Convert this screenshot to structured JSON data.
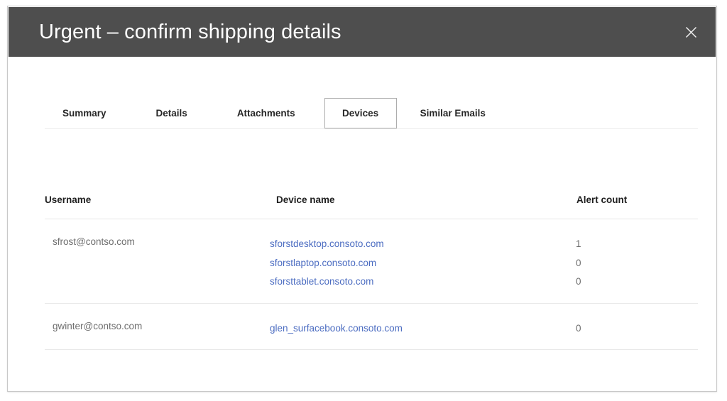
{
  "dialog": {
    "title": "Urgent – confirm shipping details",
    "close_icon": "close-icon",
    "header_bg": "#4e4e4e",
    "link_color": "#4b6cc1"
  },
  "tabs": [
    {
      "label": "Summary",
      "selected": false
    },
    {
      "label": "Details",
      "selected": false
    },
    {
      "label": "Attachments",
      "selected": false
    },
    {
      "label": "Devices",
      "selected": true
    },
    {
      "label": "Similar Emails",
      "selected": false
    }
  ],
  "table": {
    "columns": [
      "Username",
      "Device name",
      "Alert count"
    ],
    "groups": [
      {
        "username": "sfrost@contso.com",
        "devices": [
          {
            "name": "sforstdesktop.consoto.com",
            "alert_count": "1"
          },
          {
            "name": "sforstlaptop.consoto.com",
            "alert_count": "0"
          },
          {
            "name": "sforsttablet.consoto.com",
            "alert_count": "0"
          }
        ]
      },
      {
        "username": "gwinter@contso.com",
        "devices": [
          {
            "name": "glen_surfacebook.consoto.com",
            "alert_count": "0"
          }
        ]
      }
    ]
  }
}
